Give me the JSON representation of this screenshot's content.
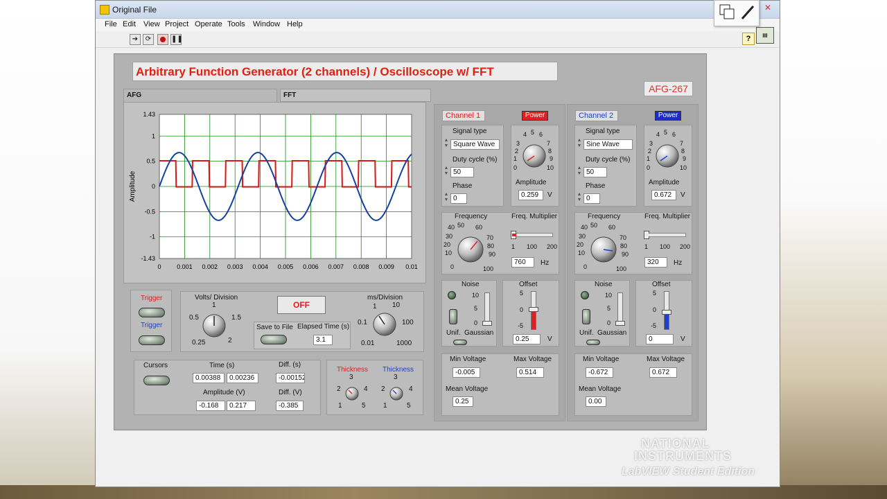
{
  "window": {
    "title": "Original File"
  },
  "menu": [
    "File",
    "Edit",
    "View",
    "Project",
    "Operate",
    "Tools",
    "Window",
    "Help"
  ],
  "toolbar": {
    "help": "?"
  },
  "header": {
    "title": "Arbitrary Function Generator (2 channels) / Oscilloscope w/ FFT",
    "id": "AFG-267"
  },
  "tabs": [
    "AFG",
    "FFT"
  ],
  "chart_data": {
    "type": "line",
    "xlabel": "",
    "ylabel": "Amplitude",
    "xlim": [
      0,
      0.01
    ],
    "ylim": [
      -1.43,
      1.43
    ],
    "x_ticks": [
      "0",
      "0.001",
      "0.002",
      "0.003",
      "0.004",
      "0.005",
      "0.006",
      "0.007",
      "0.008",
      "0.009",
      "0.01"
    ],
    "y_ticks": [
      "1.43",
      "1",
      "0.5",
      "0",
      "-0.5",
      "-1",
      "-1.43"
    ],
    "grid": true,
    "series": [
      {
        "color": "#d81818",
        "kind": "square",
        "frequency": 760,
        "duty": 50,
        "amplitude": 0.259,
        "offset": 0.25
      },
      {
        "color": "#1440a0",
        "kind": "sine",
        "frequency": 320,
        "amplitude": 0.672,
        "offset": 0
      }
    ]
  },
  "trigger": {
    "label1": "Trigger",
    "label2": "Trigger"
  },
  "volts_div": {
    "title": "Volts/ Division",
    "scale": [
      "0.5",
      "1",
      "1.5",
      "2",
      "0.25"
    ]
  },
  "off_button": "OFF",
  "save": {
    "label": "Save to File",
    "elapsed_label": "Elapsed Time (s)",
    "elapsed": "3.1"
  },
  "ms_div": {
    "title": "ms/Division",
    "scale": [
      "1",
      "10",
      "0.1",
      "100",
      "0.01",
      "1000"
    ]
  },
  "cursors": {
    "label": "Cursors",
    "time_label": "Time (s)",
    "t1": "0.00388",
    "t2": "0.00236",
    "diff_s_label": "Diff. (s)",
    "diff_s": "-0.00152",
    "amp_label": "Amplitude (V)",
    "a1": "-0.168",
    "a2": "0.217",
    "diff_v_label": "Diff. (V)",
    "diff_v": "-0.385"
  },
  "thickness": {
    "label1": "Thickness",
    "label2": "Thickness",
    "scale": [
      "3",
      "2",
      "4",
      "1",
      "5"
    ]
  },
  "channels": [
    {
      "name": "Channel 1",
      "power": "Power",
      "color": "#e02020",
      "power_bg": "#e02020",
      "signal_type_label": "Signal type",
      "signal_type": "Square Wave",
      "duty_label": "Duty cycle (%)",
      "duty": "50",
      "phase_label": "Phase",
      "phase": "0",
      "amp_label": "Amplitude",
      "amp": "0.259",
      "amp_unit": "V",
      "amp_scale": [
        "4",
        "5",
        "6",
        "3",
        "7",
        "2",
        "8",
        "1",
        "9",
        "0",
        "10"
      ],
      "freq_label": "Frequency",
      "freq_scale": [
        "40",
        "50",
        "60",
        "30",
        "70",
        "20",
        "80",
        "10",
        "90",
        "0",
        "100"
      ],
      "mult_label": "Freq. Multiplier",
      "mult_scale": [
        "1",
        "100",
        "200"
      ],
      "freq": "760",
      "freq_unit": "Hz",
      "noise_label": "Noise",
      "noise_scale": [
        "10",
        "5",
        "0"
      ],
      "unif": "Unif.",
      "gauss": "Gaussian",
      "offset_label": "Offset",
      "offset_scale": [
        "5",
        "0",
        "-5"
      ],
      "offset": "0.25",
      "offset_unit": "V",
      "min_label": "Min Voltage",
      "min": "-0.005",
      "max_label": "Max Voltage",
      "max": "0.514",
      "mean_label": "Mean Voltage",
      "mean": "0.25"
    },
    {
      "name": "Channel 2",
      "power": "Power",
      "color": "#2040c8",
      "power_bg": "#1c2cc8",
      "signal_type_label": "Signal type",
      "signal_type": "Sine Wave",
      "duty_label": "Duty cycle (%)",
      "duty": "50",
      "phase_label": "Phase",
      "phase": "0",
      "amp_label": "Amplitude",
      "amp": "0.672",
      "amp_unit": "V",
      "amp_scale": [
        "4",
        "5",
        "6",
        "3",
        "7",
        "2",
        "8",
        "1",
        "9",
        "0",
        "10"
      ],
      "freq_label": "Frequency",
      "freq_scale": [
        "40",
        "50",
        "60",
        "30",
        "70",
        "20",
        "80",
        "10",
        "90",
        "0",
        "100"
      ],
      "mult_label": "Freq. Multiplier",
      "mult_scale": [
        "1",
        "100",
        "200"
      ],
      "freq": "320",
      "freq_unit": "Hz",
      "noise_label": "Noise",
      "noise_scale": [
        "10",
        "5",
        "0"
      ],
      "unif": "Unif.",
      "gauss": "Gaussian",
      "offset_label": "Offset",
      "offset_scale": [
        "5",
        "0",
        "-5"
      ],
      "offset": "0",
      "offset_unit": "V",
      "min_label": "Min Voltage",
      "min": "-0.672",
      "max_label": "Max Voltage",
      "max": "0.672",
      "mean_label": "Mean Voltage",
      "mean": "0.00"
    }
  ],
  "watermark": {
    "line1": "NATIONAL",
    "line2": "INSTRUMENTS",
    "line3": "LabVIEW Student Edition"
  }
}
